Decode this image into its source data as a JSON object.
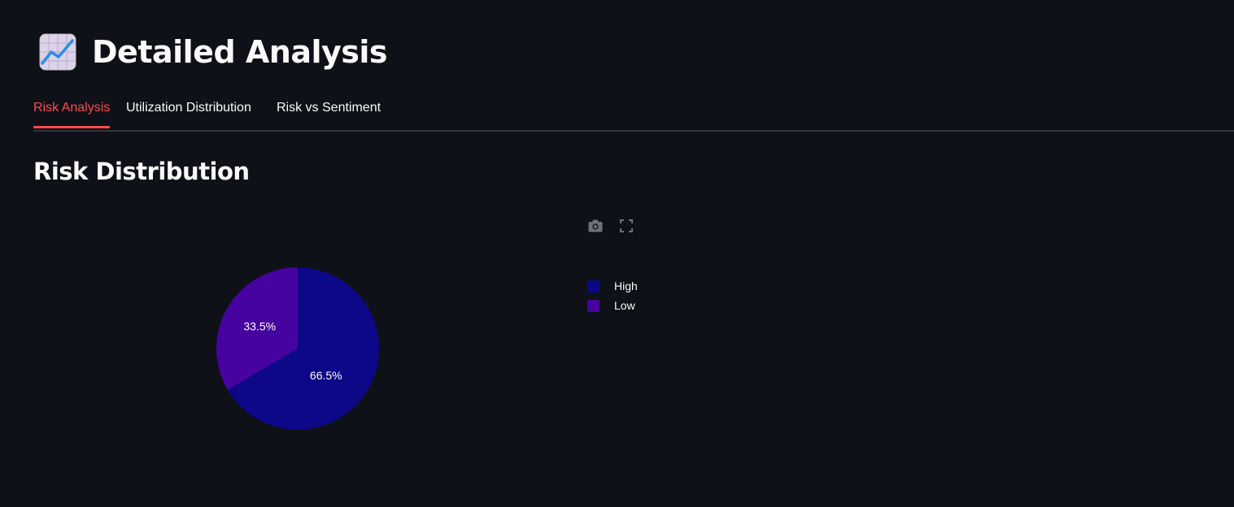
{
  "header": {
    "icon": "chart-increasing-icon",
    "title": "Detailed Analysis"
  },
  "tabs": [
    {
      "label": "Risk Analysis",
      "active": true
    },
    {
      "label": "Utilization Distribution",
      "active": false
    },
    {
      "label": "Risk vs Sentiment",
      "active": false
    }
  ],
  "section": {
    "title": "Risk Distribution"
  },
  "modebar": {
    "icons": [
      "camera-icon",
      "fullscreen-icon"
    ]
  },
  "colors": {
    "background": "#0e1117",
    "accent": "#ff4b4b",
    "text": "#fafafa",
    "tab_border": "#31333f"
  },
  "chart_data": {
    "type": "pie",
    "labels": [
      "High",
      "Low"
    ],
    "values": [
      66.5,
      33.5
    ],
    "text_labels": [
      "66.5%",
      "33.5%"
    ],
    "colors": [
      "#0d0887",
      "#46039f"
    ],
    "legend_position": "right"
  }
}
